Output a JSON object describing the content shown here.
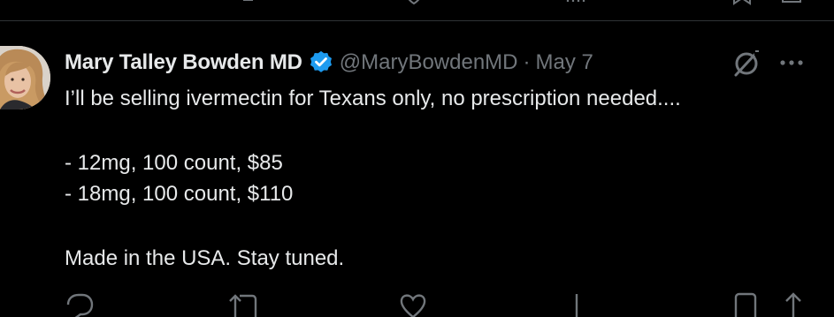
{
  "tweet": {
    "author_name": "Mary Talley Bowden MD",
    "handle": "@MaryBowdenMD",
    "separator": "·",
    "date": "May 7",
    "text_lines": [
      "I’ll be selling ivermectin for Texans only, no prescription needed....",
      "- 12mg, 100 count, $85",
      "- 18mg, 100 count, $110",
      "Made in the USA.  Stay tuned."
    ]
  },
  "icons": {
    "verified": "verified-badge-icon",
    "grok": "grok-icon",
    "more": "more-options-icon"
  },
  "colors": {
    "background": "#000000",
    "text": "#e7e9ea",
    "secondary": "#71767b",
    "verified": "#1d9bf0",
    "divider": "#2f3336"
  }
}
